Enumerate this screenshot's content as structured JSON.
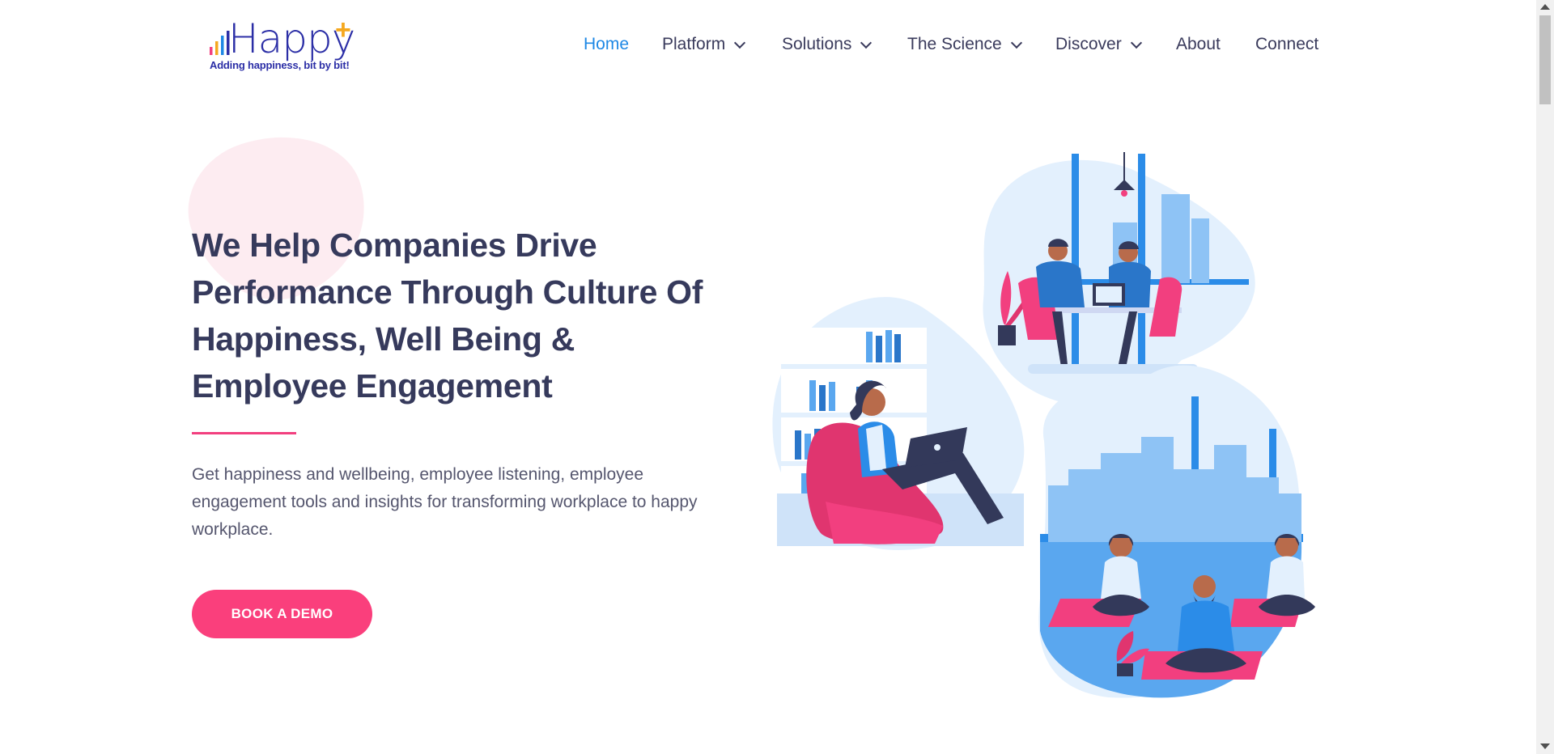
{
  "brand": {
    "name": "Happy",
    "plus": "+",
    "tagline": "Adding happiness, bit by bit!",
    "colors": {
      "wordmark": "#2b2ea6",
      "plus": "#f5a81f",
      "bars": [
        "#f23f7f",
        "#f5a81f",
        "#1e88e5",
        "#2b2ea6"
      ]
    }
  },
  "nav": {
    "items": [
      {
        "label": "Home",
        "active": true,
        "dropdown": false
      },
      {
        "label": "Platform",
        "dropdown": true
      },
      {
        "label": "Solutions",
        "dropdown": true
      },
      {
        "label": "The Science",
        "dropdown": true
      },
      {
        "label": "Discover",
        "dropdown": true
      },
      {
        "label": "About",
        "dropdown": false
      },
      {
        "label": "Connect",
        "dropdown": false
      }
    ],
    "active_color": "#1e88e5"
  },
  "hero": {
    "title": "We Help Companies Drive Performance Through Culture Of Happiness, Well Being & Employee Engagement",
    "description": "Get happiness and wellbeing, employee listening, employee engagement tools and insights for transforming workplace to happy workplace.",
    "cta_label": "BOOK A DEMO",
    "accent_color": "#fa3f7c"
  },
  "illustration": {
    "scenes": [
      "meeting-scene",
      "remote-work-scene",
      "yoga-scene"
    ],
    "icon": "workplace-illustration"
  }
}
